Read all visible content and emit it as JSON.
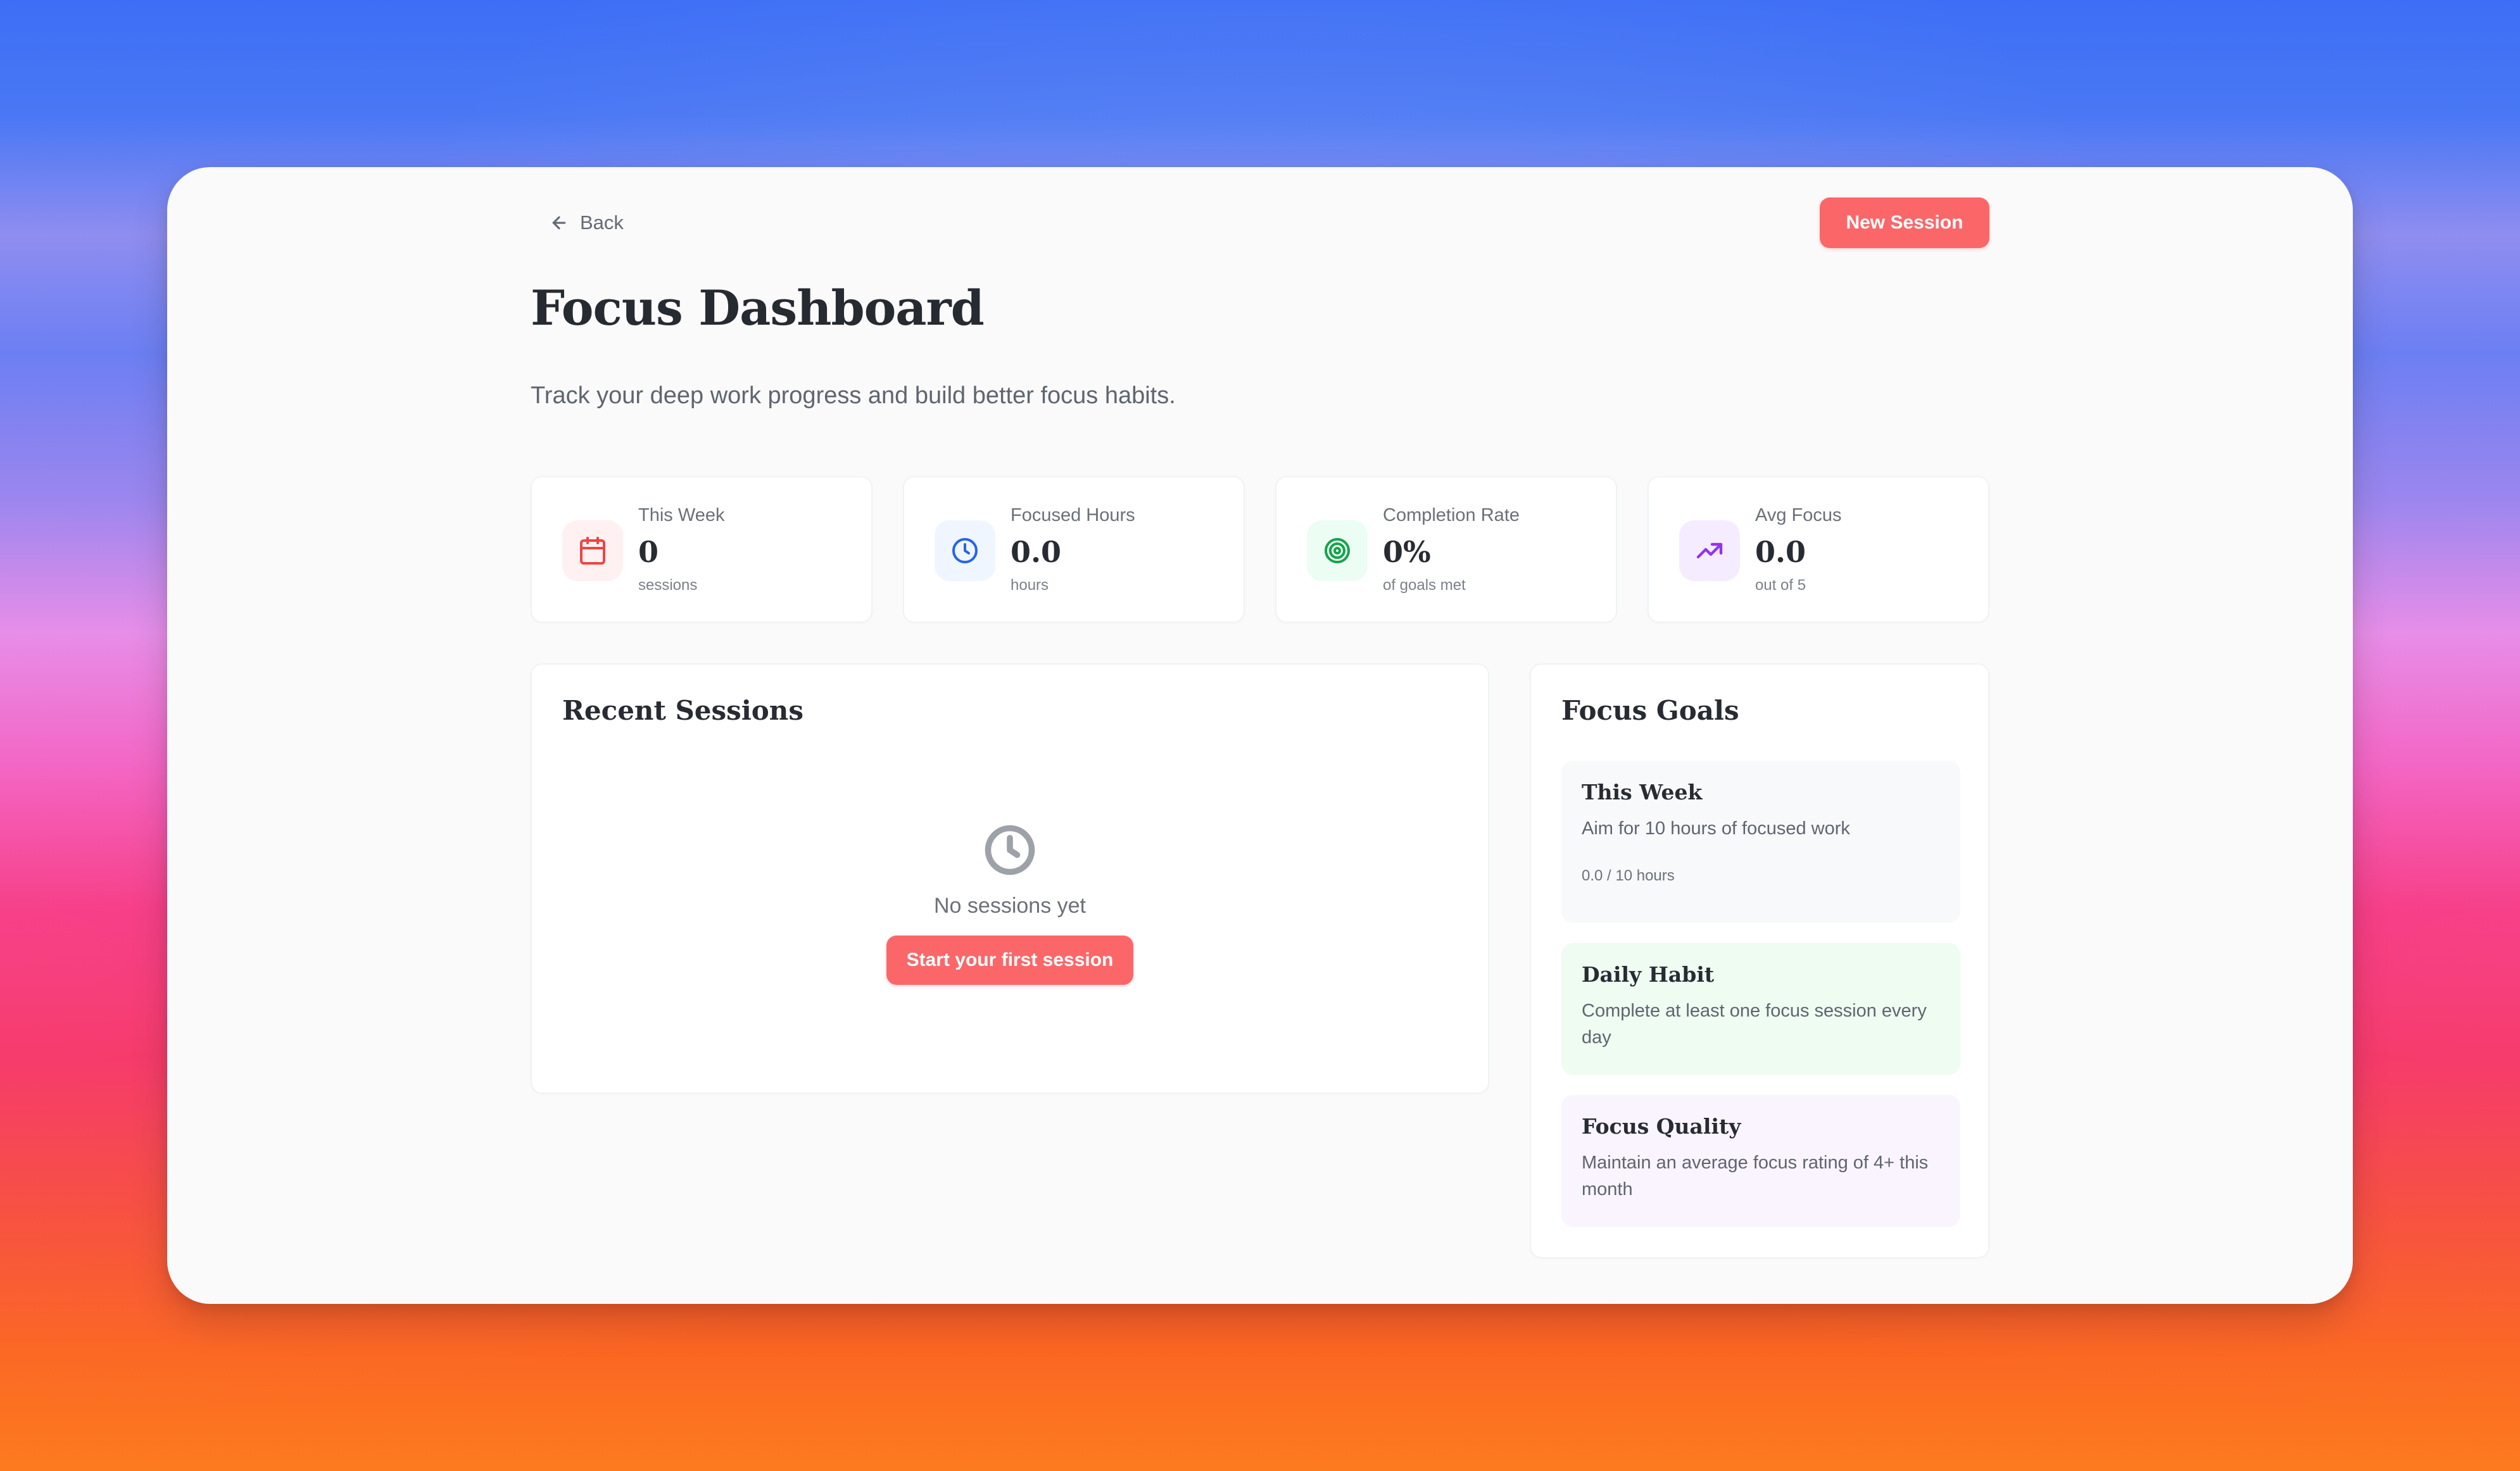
{
  "navigation": {
    "back_label": "Back",
    "new_session_label": "New Session"
  },
  "header": {
    "title": "Focus Dashboard",
    "subtitle": "Track your deep work progress and build better focus habits."
  },
  "stats": [
    {
      "label": "This Week",
      "value": "0",
      "subtext": "sessions",
      "icon": "calendar-icon",
      "accent": "#ef4444",
      "tint": "#fff1f2"
    },
    {
      "label": "Focused Hours",
      "value": "0.0",
      "subtext": "hours",
      "icon": "clock-icon",
      "accent": "#2563eb",
      "tint": "#eff6ff"
    },
    {
      "label": "Completion Rate",
      "value": "0%",
      "subtext": "of goals met",
      "icon": "target-icon",
      "accent": "#16a34a",
      "tint": "#ecfdf3"
    },
    {
      "label": "Avg Focus",
      "value": "0.0",
      "subtext": "out of 5",
      "icon": "trending-up-icon",
      "accent": "#9333ea",
      "tint": "#f5edff"
    }
  ],
  "recent_sessions": {
    "title": "Recent Sessions",
    "empty_text": "No sessions yet",
    "empty_button_label": "Start your first session",
    "empty_icon": "clock-icon"
  },
  "focus_goals": {
    "title": "Focus Goals",
    "items": [
      {
        "title": "This Week",
        "description": "Aim for 10 hours of focused work",
        "progress_text": "0.0 / 10 hours",
        "background": "#f8f9fb"
      },
      {
        "title": "Daily Habit",
        "description": "Complete at least one focus session every day",
        "background": "#eefcf1"
      },
      {
        "title": "Focus Quality",
        "description": "Maintain an average focus rating of 4+ this month",
        "background": "#faf4ff"
      }
    ]
  },
  "colors": {
    "primary_button": "#fb6769",
    "page_background": "#fafafa",
    "card_background": "#ffffff"
  }
}
